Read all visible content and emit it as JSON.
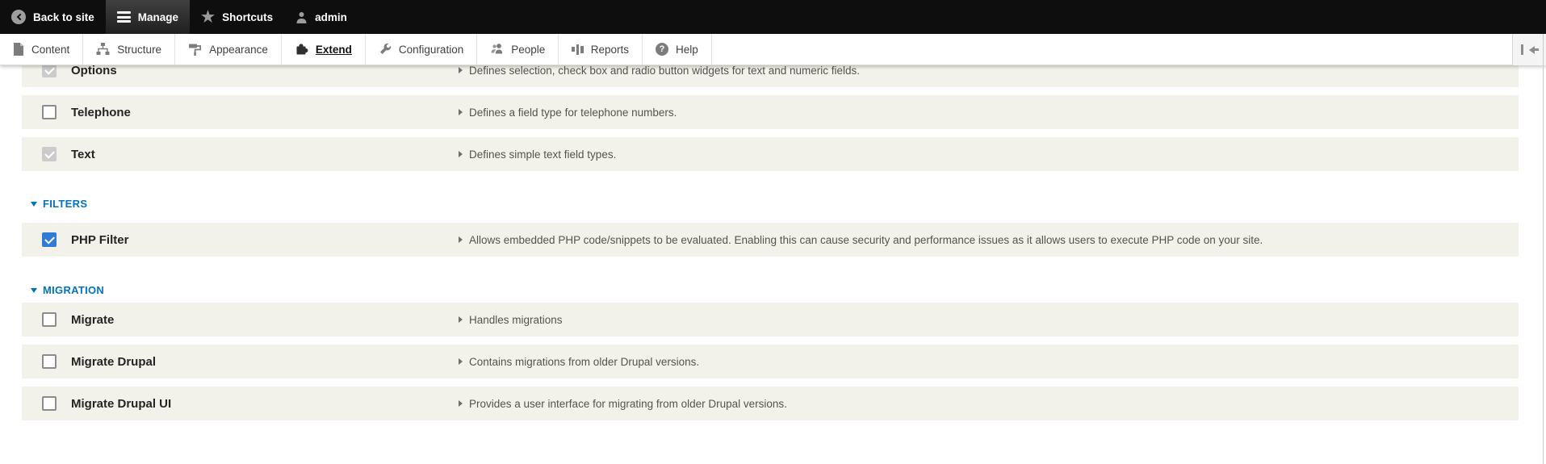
{
  "admin_bar": {
    "back_to_site": "Back to site",
    "manage": "Manage",
    "shortcuts": "Shortcuts",
    "user": "admin"
  },
  "toolbar": {
    "tabs": [
      {
        "label": "Content",
        "icon": "document-icon"
      },
      {
        "label": "Structure",
        "icon": "sitemap-icon"
      },
      {
        "label": "Appearance",
        "icon": "paintbrush-icon"
      },
      {
        "label": "Extend",
        "icon": "puzzle-icon",
        "active": true
      },
      {
        "label": "Configuration",
        "icon": "wrench-icon"
      },
      {
        "label": "People",
        "icon": "people-icon"
      },
      {
        "label": "Reports",
        "icon": "bar-chart-icon"
      },
      {
        "label": "Help",
        "icon": "help-icon"
      }
    ],
    "orientation_toggle_icon": "collapse-left-icon"
  },
  "modules": {
    "sections": [
      {
        "title": "",
        "rows": [
          {
            "name": "Options",
            "description": "Defines selection, check box and radio button widgets for text and numeric fields.",
            "checkbox": "checked-disabled"
          },
          {
            "name": "Telephone",
            "description": "Defines a field type for telephone numbers.",
            "checkbox": "unchecked"
          },
          {
            "name": "Text",
            "description": "Defines simple text field types.",
            "checkbox": "checked-disabled"
          }
        ]
      },
      {
        "title": "FILTERS",
        "rows": [
          {
            "name": "PHP Filter",
            "description": "Allows embedded PHP code/snippets to be evaluated. Enabling this can cause security and performance issues as it allows users to execute PHP code on your site.",
            "checkbox": "checked"
          }
        ]
      },
      {
        "title": "MIGRATION",
        "rows": [
          {
            "name": "Migrate",
            "description": "Handles migrations",
            "checkbox": "unchecked"
          },
          {
            "name": "Migrate Drupal",
            "description": "Contains migrations from older Drupal versions.",
            "checkbox": "unchecked"
          },
          {
            "name": "Migrate Drupal UI",
            "description": "Provides a user interface for migrating from older Drupal versions.",
            "checkbox": "unchecked"
          }
        ]
      }
    ]
  },
  "colors": {
    "admin_bar_bg": "#0e0e0e",
    "section_header": "#0074bd",
    "checkbox_checked": "#2e7cd5",
    "row_bg": "#f2f2ea"
  }
}
